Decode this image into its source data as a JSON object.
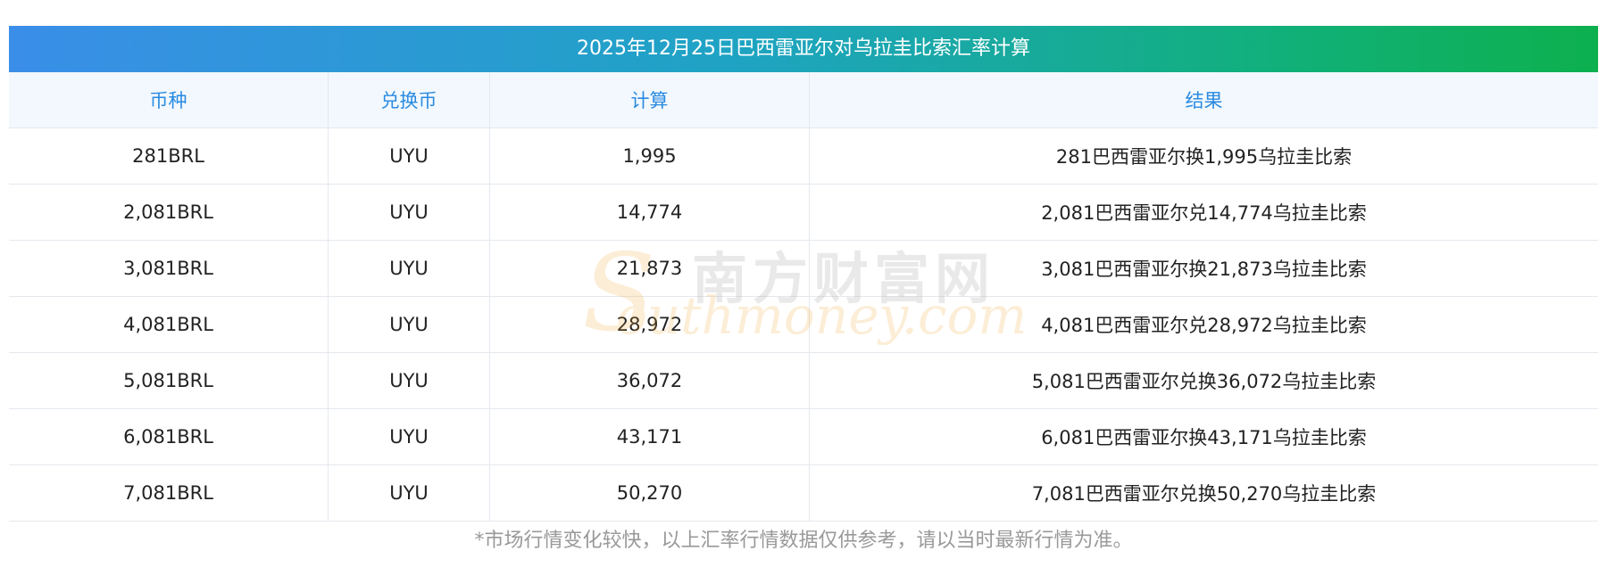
{
  "title": "2025年12月25日巴西雷亚尔对乌拉圭比索汇率计算",
  "headers": {
    "currency": "币种",
    "exchange": "兑换币",
    "calc": "计算",
    "result": "结果"
  },
  "rows": [
    {
      "currency": "281BRL",
      "exchange": "UYU",
      "calc": "1,995",
      "result": "281巴西雷亚尔换1,995乌拉圭比索"
    },
    {
      "currency": "2,081BRL",
      "exchange": "UYU",
      "calc": "14,774",
      "result": "2,081巴西雷亚尔兑14,774乌拉圭比索"
    },
    {
      "currency": "3,081BRL",
      "exchange": "UYU",
      "calc": "21,873",
      "result": "3,081巴西雷亚尔换21,873乌拉圭比索"
    },
    {
      "currency": "4,081BRL",
      "exchange": "UYU",
      "calc": "28,972",
      "result": "4,081巴西雷亚尔兑28,972乌拉圭比索"
    },
    {
      "currency": "5,081BRL",
      "exchange": "UYU",
      "calc": "36,072",
      "result": "5,081巴西雷亚尔兑换36,072乌拉圭比索"
    },
    {
      "currency": "6,081BRL",
      "exchange": "UYU",
      "calc": "43,171",
      "result": "6,081巴西雷亚尔换43,171乌拉圭比索"
    },
    {
      "currency": "7,081BRL",
      "exchange": "UYU",
      "calc": "50,270",
      "result": "7,081巴西雷亚尔兑换50,270乌拉圭比索"
    }
  ],
  "watermark": {
    "cn": "南方财富网",
    "en": "outhmoney.com",
    "s": "S"
  },
  "footnote": "*市场行情变化较快，以上汇率行情数据仅供参考，请以当时最新行情为准。",
  "colors": {
    "title_gradient_start": "#3a8ee8",
    "title_gradient_end": "#0db04e",
    "header_bg": "#f2f8fd",
    "header_text": "#2a8ae0",
    "footnote_text": "#999999"
  }
}
